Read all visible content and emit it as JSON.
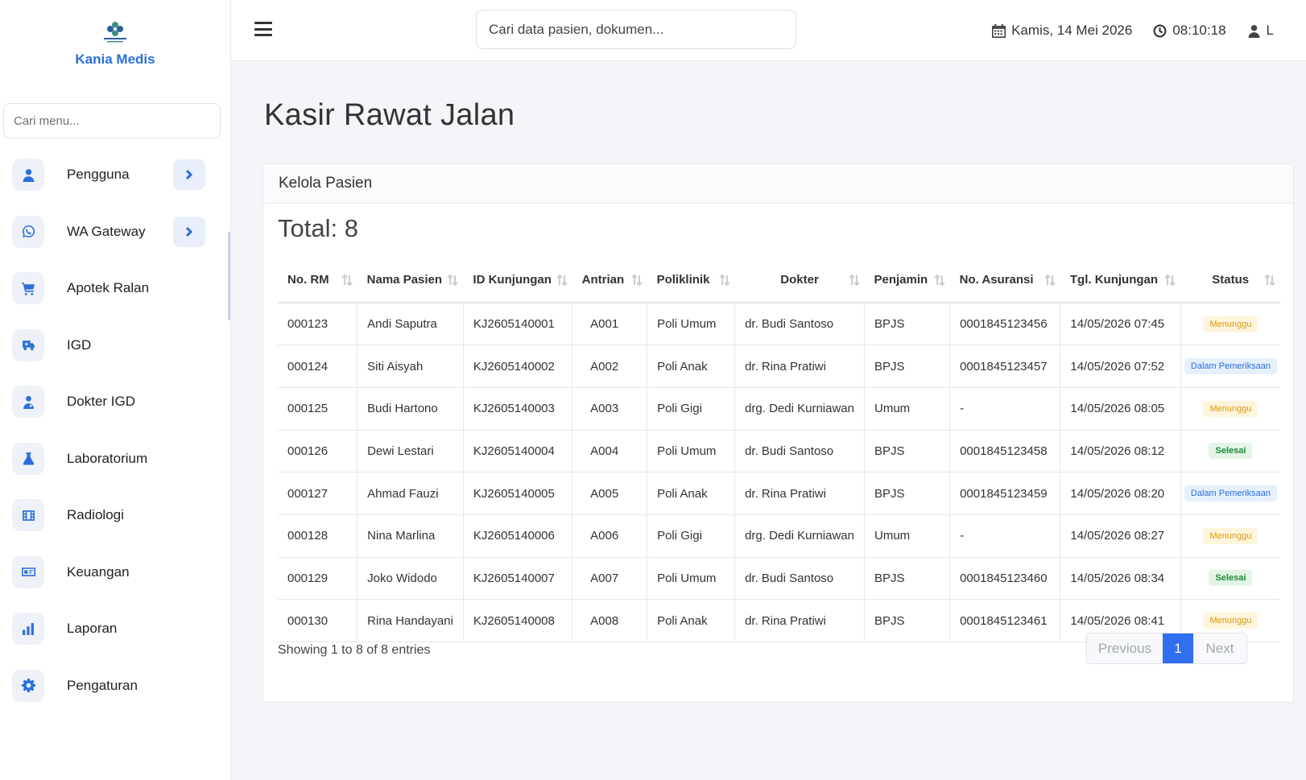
{
  "brand": {
    "name": "Kania Medis",
    "logo_icon": "flower-logo-icon",
    "logo_color": "#2a6fdb"
  },
  "sidebar": {
    "search_placeholder": "Cari menu...",
    "items": [
      {
        "label": "Pengguna",
        "icon": "user-icon",
        "has_submenu": true
      },
      {
        "label": "WA Gateway",
        "icon": "whatsapp-icon",
        "has_submenu": true
      },
      {
        "label": "Apotek Ralan",
        "icon": "cart-icon",
        "has_submenu": false
      },
      {
        "label": "IGD",
        "icon": "ambulance-icon",
        "has_submenu": false
      },
      {
        "label": "Dokter IGD",
        "icon": "doctor-icon",
        "has_submenu": false
      },
      {
        "label": "Laboratorium",
        "icon": "flask-icon",
        "has_submenu": false
      },
      {
        "label": "Radiologi",
        "icon": "film-icon",
        "has_submenu": false
      },
      {
        "label": "Keuangan",
        "icon": "money-icon",
        "has_submenu": false
      },
      {
        "label": "Laporan",
        "icon": "bar-chart-icon",
        "has_submenu": false
      },
      {
        "label": "Pengaturan",
        "icon": "gear-icon",
        "has_submenu": false
      }
    ]
  },
  "topbar": {
    "search_placeholder": "Cari data pasien, dokumen...",
    "date": "Kamis, 14 Mei 2026",
    "time": "08:10:18",
    "user_initial": "L"
  },
  "page": {
    "title": "Kasir Rawat Jalan",
    "card_title": "Kelola Pasien",
    "total_label": "Total: 8"
  },
  "table": {
    "columns": [
      "No. RM",
      "Nama Pasien",
      "ID Kunjungan",
      "Antrian",
      "Poliklinik",
      "Dokter",
      "Penjamin",
      "No. Asuransi",
      "Tgl. Kunjungan",
      "Status"
    ],
    "rows": [
      [
        "000123",
        "Andi Saputra",
        "KJ2605140001",
        "A001",
        "Poli Umum",
        "dr. Budi Santoso",
        "BPJS",
        "0001845123456",
        "14/05/2026 07:45",
        "Menunggu"
      ],
      [
        "000124",
        "Siti Aisyah",
        "KJ2605140002",
        "A002",
        "Poli Anak",
        "dr. Rina Pratiwi",
        "BPJS",
        "0001845123457",
        "14/05/2026 07:52",
        "Dalam Pemeriksaan"
      ],
      [
        "000125",
        "Budi Hartono",
        "KJ2605140003",
        "A003",
        "Poli Gigi",
        "drg. Dedi Kurniawan",
        "Umum",
        "-",
        "14/05/2026 08:05",
        "Menunggu"
      ],
      [
        "000126",
        "Dewi Lestari",
        "KJ2605140004",
        "A004",
        "Poli Umum",
        "dr. Budi Santoso",
        "BPJS",
        "0001845123458",
        "14/05/2026 08:12",
        "Selesai"
      ],
      [
        "000127",
        "Ahmad Fauzi",
        "KJ2605140005",
        "A005",
        "Poli Anak",
        "dr. Rina Pratiwi",
        "BPJS",
        "0001845123459",
        "14/05/2026 08:20",
        "Dalam Pemeriksaan"
      ],
      [
        "000128",
        "Nina Marlina",
        "KJ2605140006",
        "A006",
        "Poli Gigi",
        "drg. Dedi Kurniawan",
        "Umum",
        "-",
        "14/05/2026 08:27",
        "Menunggu"
      ],
      [
        "000129",
        "Joko Widodo",
        "KJ2605140007",
        "A007",
        "Poli Umum",
        "dr. Budi Santoso",
        "BPJS",
        "0001845123460",
        "14/05/2026 08:34",
        "Selesai"
      ],
      [
        "000130",
        "Rina Handayani",
        "KJ2605140008",
        "A008",
        "Poli Anak",
        "dr. Rina Pratiwi",
        "BPJS",
        "0001845123461",
        "14/05/2026 08:41",
        "Menunggu"
      ]
    ]
  },
  "status_colors": {
    "Menunggu": "#d59a12",
    "Dalam Pemeriksaan": "#2a6fdb",
    "Selesai": "#1f8a3a"
  },
  "footer": {
    "showing": "Showing 1 to 8 of 8 entries",
    "previous": "Previous",
    "current_page": "1",
    "next": "Next"
  }
}
